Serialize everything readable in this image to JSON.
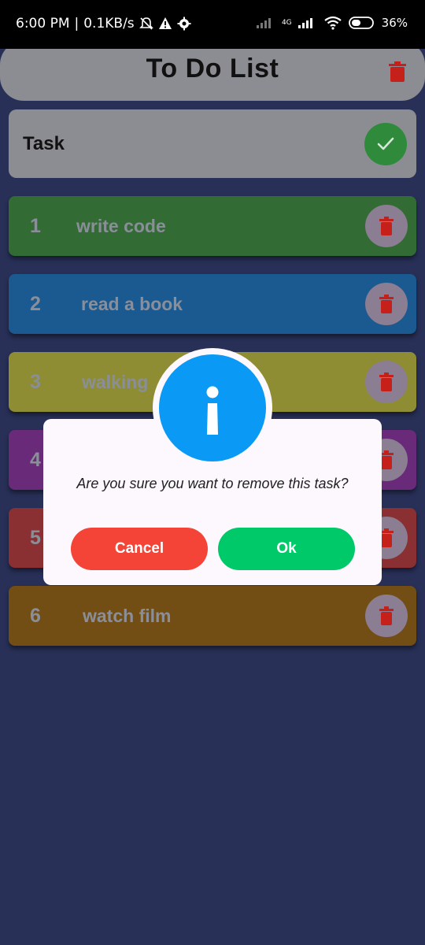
{
  "status_bar": {
    "time": "6:00 PM",
    "speed": "0.1KB/s",
    "network": "4G",
    "battery": "36%"
  },
  "app_bar": {
    "title": "To Do List"
  },
  "task_input": {
    "value": "Task"
  },
  "items": [
    {
      "number": "1",
      "title": "write code"
    },
    {
      "number": "2",
      "title": "read a book"
    },
    {
      "number": "3",
      "title": "walking"
    },
    {
      "number": "4",
      "title": ""
    },
    {
      "number": "5",
      "title": ""
    },
    {
      "number": "6",
      "title": "watch film"
    }
  ],
  "dialog": {
    "message": "Are you sure you want to remove this task?",
    "cancel_label": "Cancel",
    "ok_label": "Ok"
  },
  "colors": {
    "background": "#283058",
    "accent_info": "#0a99f5",
    "cancel": "#f44337",
    "ok": "#00c96a",
    "item_1": "#336b35",
    "item_2": "#1b5a91",
    "item_3": "#8f8d34",
    "item_4": "#692a7a",
    "item_5": "#8a3032",
    "item_6": "#734e14"
  },
  "icons": {
    "status": [
      "mute-bell-icon",
      "warning-icon",
      "gear-icon",
      "signal-icon",
      "wifi-icon",
      "battery-icon"
    ],
    "app_bar": "trash-icon",
    "task_input": "check-icon",
    "item_action": "trash-icon",
    "dialog": "info-icon"
  }
}
